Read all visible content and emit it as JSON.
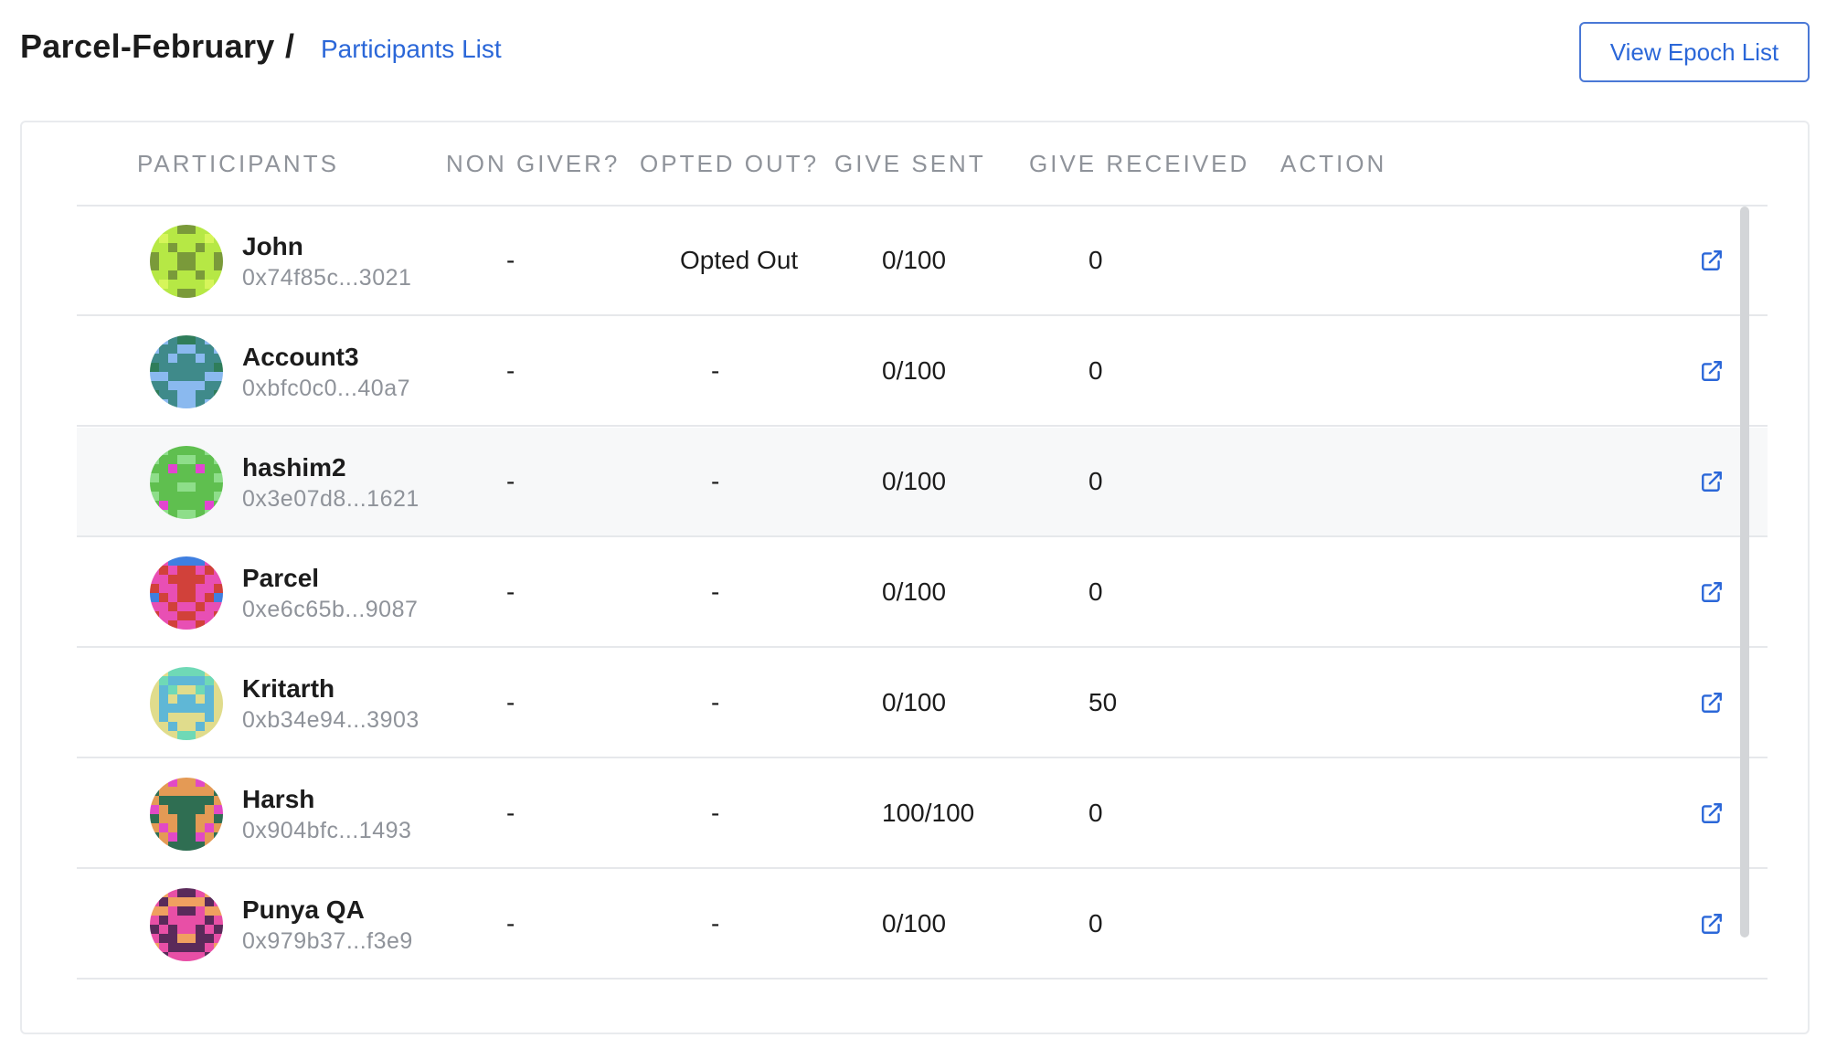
{
  "header": {
    "breadcrumb_root": "Parcel-February",
    "breadcrumb_separator": "/",
    "breadcrumb_current": "Participants List",
    "view_epoch_button": "View Epoch List"
  },
  "table": {
    "columns": [
      "PARTICIPANTS",
      "NON GIVER?",
      "OPTED OUT?",
      "GIVE SENT",
      "GIVE RECEIVED",
      "ACTION"
    ],
    "rows": [
      {
        "name": "John",
        "address": "0x74f85c...3021",
        "non_giver": "-",
        "opted_out": "Opted Out",
        "give_sent": "0/100",
        "give_received": "0"
      },
      {
        "name": "Account3",
        "address": "0xbfc0c0...40a7",
        "non_giver": "-",
        "opted_out": "-",
        "give_sent": "0/100",
        "give_received": "0"
      },
      {
        "name": "hashim2",
        "address": "0x3e07d8...1621",
        "non_giver": "-",
        "opted_out": "-",
        "give_sent": "0/100",
        "give_received": "0"
      },
      {
        "name": "Parcel",
        "address": "0xe6c65b...9087",
        "non_giver": "-",
        "opted_out": "-",
        "give_sent": "0/100",
        "give_received": "0"
      },
      {
        "name": "Kritarth",
        "address": "0xb34e94...3903",
        "non_giver": "-",
        "opted_out": "-",
        "give_sent": "0/100",
        "give_received": "50"
      },
      {
        "name": "Harsh",
        "address": "0x904bfc...1493",
        "non_giver": "-",
        "opted_out": "-",
        "give_sent": "100/100",
        "give_received": "0"
      },
      {
        "name": "Punya QA",
        "address": "0x979b37...f3e9",
        "non_giver": "-",
        "opted_out": "-",
        "give_sent": "0/100",
        "give_received": "0"
      }
    ]
  },
  "icons": {
    "action": "external-link-icon",
    "avatar": "identicon-avatar"
  },
  "colors": {
    "accent": "#2b67d8",
    "header_text": "#8f939a",
    "avatar_palettes": [
      [
        "#7a9a3a",
        "#b6e845",
        "#d6f55a"
      ],
      [
        "#8ab9ef",
        "#3f8a8a",
        "#2f7d5a"
      ],
      [
        "#8ede8a",
        "#5fbf4f",
        "#e245d0"
      ],
      [
        "#e84fb4",
        "#d1413a",
        "#3f7fe0"
      ],
      [
        "#6fd9b6",
        "#e0dc8c",
        "#5fb7d6"
      ],
      [
        "#2f6e52",
        "#e49a55",
        "#e249c6"
      ],
      [
        "#e84fa6",
        "#5a2a5a",
        "#f0a060"
      ]
    ]
  }
}
